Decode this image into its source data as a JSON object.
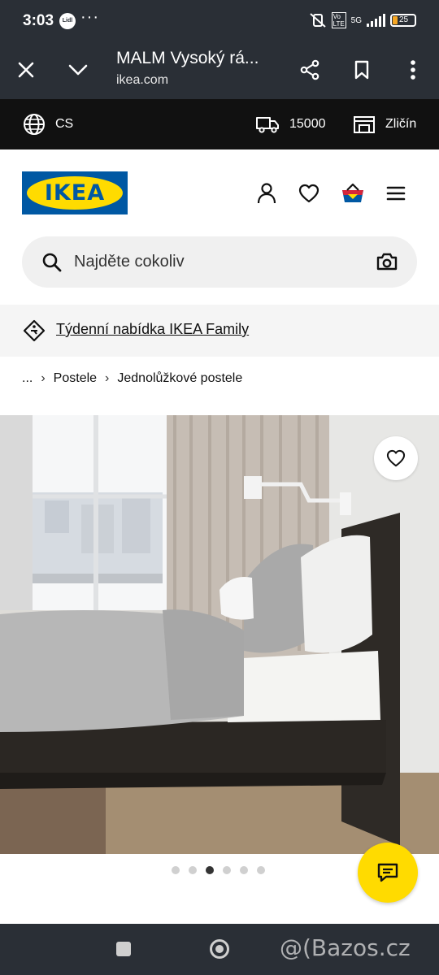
{
  "status_bar": {
    "time": "3:03",
    "lidl_label": "Lidl",
    "more": "···",
    "network": "5G",
    "volte": "Vo LTE",
    "battery": "25"
  },
  "browser": {
    "title": "MALM Vysoký rá...",
    "url": "ikea.com"
  },
  "topbar": {
    "language": "CS",
    "postcode": "15000",
    "store": "Zličín"
  },
  "header": {
    "logo_text": "IKEA"
  },
  "search": {
    "placeholder": "Najděte cokoliv"
  },
  "family_banner": {
    "text": "Týdenní nabídka IKEA Family"
  },
  "breadcrumb": {
    "ellipsis": "...",
    "items": [
      "Postele",
      "Jednolůžkové postele"
    ]
  },
  "gallery": {
    "total": 6,
    "active_index": 3
  },
  "watermark": "@(Bazos.cz",
  "colors": {
    "ikea_blue": "#0058a3",
    "ikea_yellow": "#ffdb00",
    "system_bar": "#2a2f36"
  }
}
